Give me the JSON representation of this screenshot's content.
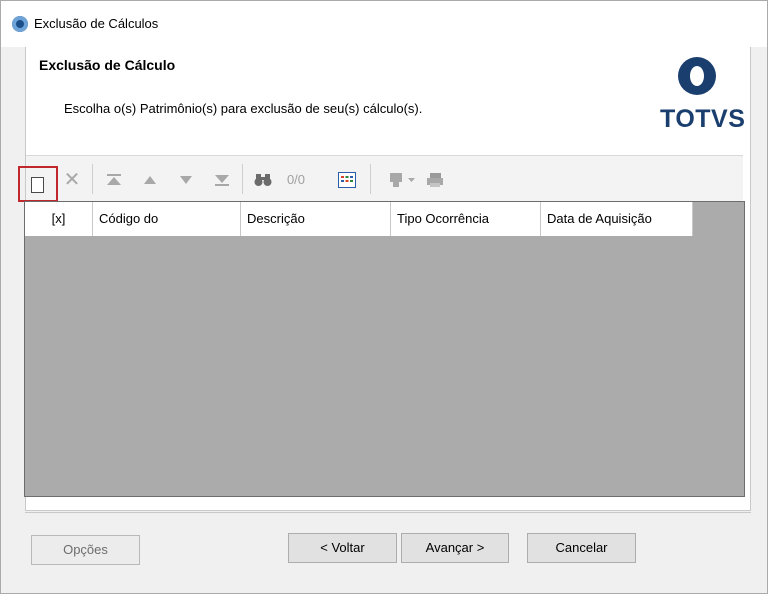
{
  "window": {
    "title": "Exclusão de Cálculos"
  },
  "header": {
    "title": "Exclusão de Cálculo",
    "subtitle": "Escolha o(s) Patrimônio(s) para exclusão de seu(s)  cálculo(s).",
    "logo_text": "TOTVS",
    "logo_color": "#1a3f6e"
  },
  "toolbar": {
    "new_icon": "new-document-icon",
    "delete_icon": "delete-x-icon",
    "first_icon": "first-record-icon",
    "prev_icon": "previous-record-icon",
    "next_icon": "next-record-icon",
    "last_icon": "last-record-icon",
    "find_icon": "binoculars-icon",
    "record_counter": "0/0",
    "grid_icon": "grid-layout-icon",
    "tools_icon": "tools-icon",
    "print_icon": "print-icon",
    "highlight_color": "#c0282e"
  },
  "grid": {
    "columns": [
      "[x]",
      "Código do",
      "Descrição",
      "Tipo Ocorrência",
      "Data de Aquisição"
    ],
    "rows": [],
    "background": "#ababab"
  },
  "footer": {
    "options_label": "Opções",
    "back_label": "< Voltar",
    "next_label": "Avançar >",
    "cancel_label": "Cancelar"
  }
}
